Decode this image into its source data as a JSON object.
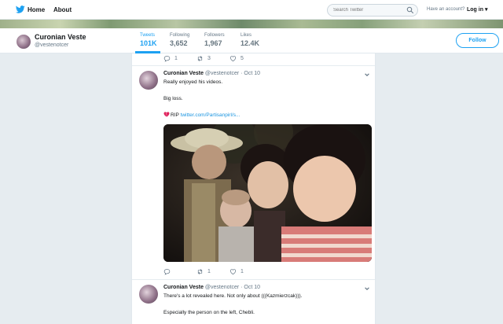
{
  "topnav": {
    "home_label": "Home",
    "about_label": "About",
    "search_placeholder": "Search Twitter",
    "have_account": "Have an account?",
    "login_label": "Log in ▾"
  },
  "profile": {
    "name": "Curonian Veste",
    "handle": "@vestenotcer",
    "follow_label": "Follow",
    "stats": [
      {
        "label": "Tweets",
        "value": "101K"
      },
      {
        "label": "Following",
        "value": "3,652"
      },
      {
        "label": "Followers",
        "value": "1,967"
      },
      {
        "label": "Likes",
        "value": "12.4K"
      }
    ]
  },
  "prev_tweet_actions": {
    "replies": "1",
    "retweets": "3",
    "likes": "5"
  },
  "tweets": [
    {
      "name": "Curonian Veste",
      "meta": "@vestenotcer · Oct 10",
      "lines": [
        "Really enjoyed his videos.",
        "Big loss."
      ],
      "rip_prefix": "RIP ",
      "link": "twitter.com/Partisanpirl/s...",
      "actions": {
        "replies": "",
        "retweets": "1",
        "likes": "1"
      }
    },
    {
      "name": "Curonian Veste",
      "meta": "@vestenotcer · Oct 10",
      "lines": [
        "There's a lot revealed here. Not only about (((Kazmierzcak))).",
        "Especially the person on the left, Chebli."
      ]
    }
  ],
  "colors": {
    "accent": "#1da1f2",
    "link": "#1b95e0",
    "background": "#e6ecf0",
    "heart": "#e0245e"
  }
}
